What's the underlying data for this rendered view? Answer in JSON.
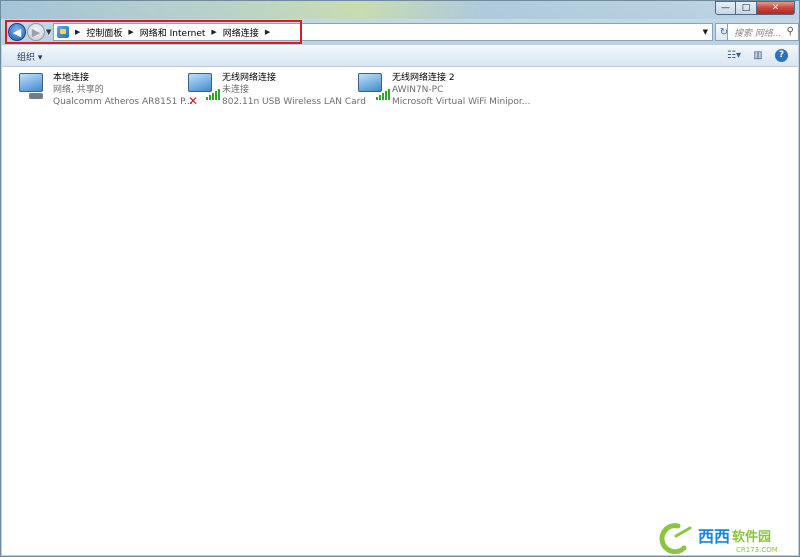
{
  "window": {
    "caption": {
      "minimize": "—",
      "maximize": "□",
      "close": "✕"
    }
  },
  "nav": {
    "back_icon": "back-arrow-icon",
    "forward_icon": "forward-arrow-icon",
    "breadcrumb": [
      "控制面板",
      "网络和 Internet",
      "网络连接"
    ],
    "search_placeholder": "搜索 网络...",
    "highlight_color": "#d21f27"
  },
  "toolbar": {
    "organize_label": "组织 ▾"
  },
  "connections": [
    {
      "name": "本地连接",
      "status": "网络, 共享的",
      "device": "Qualcomm Atheros AR8151 P...",
      "type": "wired"
    },
    {
      "name": "无线网络连接",
      "status": "未连接",
      "device": "802.11n USB Wireless LAN Card",
      "type": "wireless-disconnected"
    },
    {
      "name": "无线网络连接 2",
      "status": "AWIN7N-PC",
      "device": "Microsoft Virtual WiFi Minipor...",
      "type": "wireless"
    }
  ],
  "watermark": {
    "brand": "西西软件园",
    "domain": "CR173.COM"
  }
}
